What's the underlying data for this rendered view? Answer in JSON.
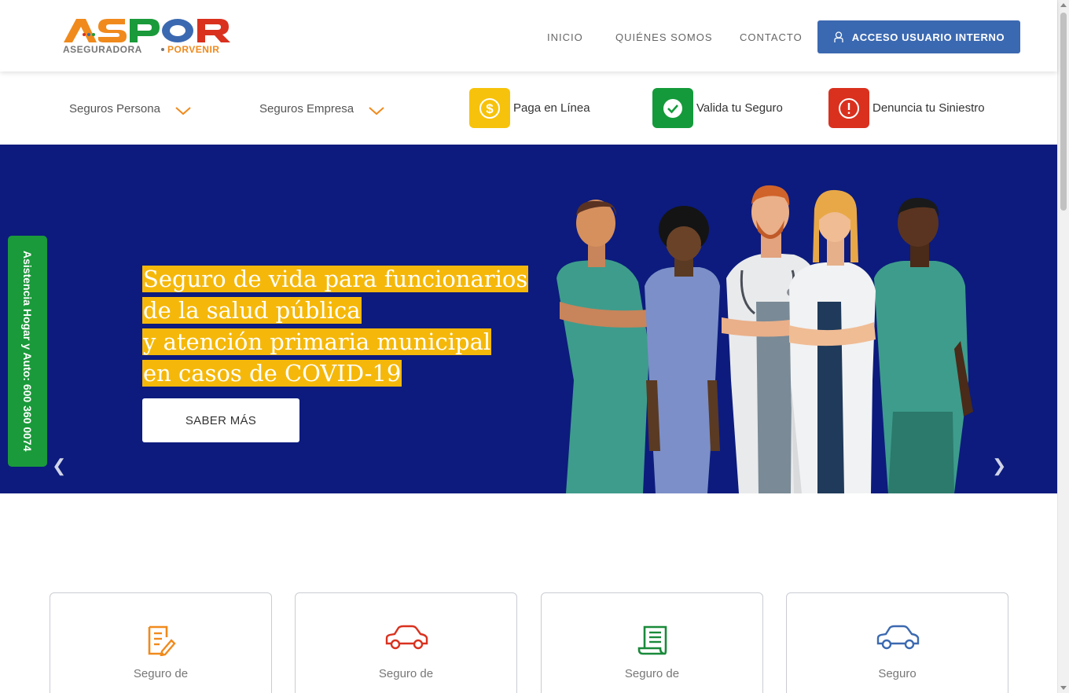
{
  "brand": {
    "name": "ASPOR",
    "tagline_left": "ASEGURADORA",
    "tagline_right": "PORVENIR"
  },
  "nav": {
    "items": [
      "INICIO",
      "QUIÉNES SOMOS",
      "CONTACTO"
    ],
    "access_label": "ACCESO USUARIO INTERNO"
  },
  "subbar": {
    "dropdowns": [
      "Seguros Persona",
      "Seguros Empresa"
    ],
    "quick_links": [
      {
        "label": "Paga en Línea",
        "icon": "dollar-icon",
        "color": "#f7c20b"
      },
      {
        "label": "Valida tu Seguro",
        "icon": "check-icon",
        "color": "#149a3a"
      },
      {
        "label": "Denuncia tu Siniestro",
        "icon": "alert-icon",
        "color": "#d9311e"
      }
    ]
  },
  "hero": {
    "lines": [
      "Seguro de vida para funcionarios",
      "de la salud pública",
      "y atención primaria municipal",
      "en casos de COVID-19"
    ],
    "button": "SABER MÁS",
    "bg_color": "#0c1b7d",
    "highlight_color": "#f5b80a"
  },
  "side_tab": {
    "label": "Asistencia Hogar y Auto: 600 360 0074"
  },
  "cards": [
    {
      "label": "Seguro de",
      "icon": "document-edit-icon",
      "color": "#f08a1c"
    },
    {
      "label": "Seguro de",
      "icon": "car-icon",
      "color": "#d9311e"
    },
    {
      "label": "Seguro de",
      "icon": "scroll-icon",
      "color": "#1a8a3a"
    },
    {
      "label": "Seguro",
      "icon": "car-icon",
      "color": "#3b69b1"
    }
  ]
}
